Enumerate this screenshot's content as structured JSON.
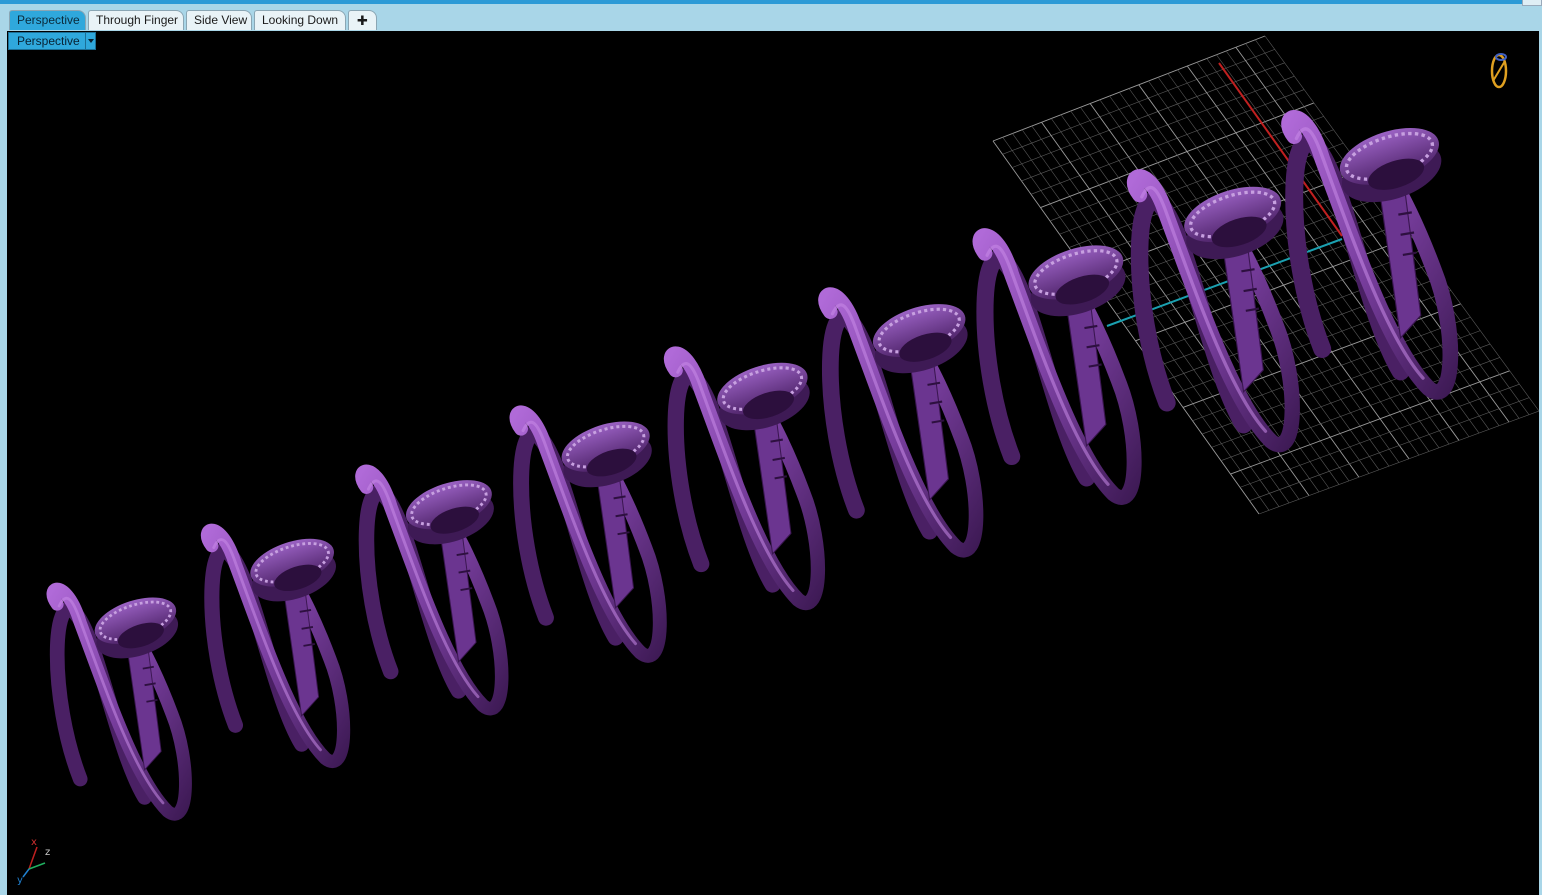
{
  "tabs": [
    {
      "label": "Perspective",
      "active": true
    },
    {
      "label": "Through Finger",
      "active": false
    },
    {
      "label": "Side View",
      "active": false
    },
    {
      "label": "Looking Down",
      "active": false
    }
  ],
  "add_tab_icon": "plus-icon",
  "viewport": {
    "title": "Perspective",
    "background": "#000000"
  },
  "scene": {
    "object": "nail ring",
    "object_color": "#7a3fa0",
    "ring_count": 9
  },
  "axis_indicator": {
    "x_label": "x",
    "y_label": "y",
    "z_label": "z"
  },
  "colors": {
    "frame": "#a9d6e8",
    "accent": "#2fa8dc",
    "grid": "#8a8a8a",
    "x_axis": "#c02020",
    "y_axis": "#1aa0b0"
  }
}
